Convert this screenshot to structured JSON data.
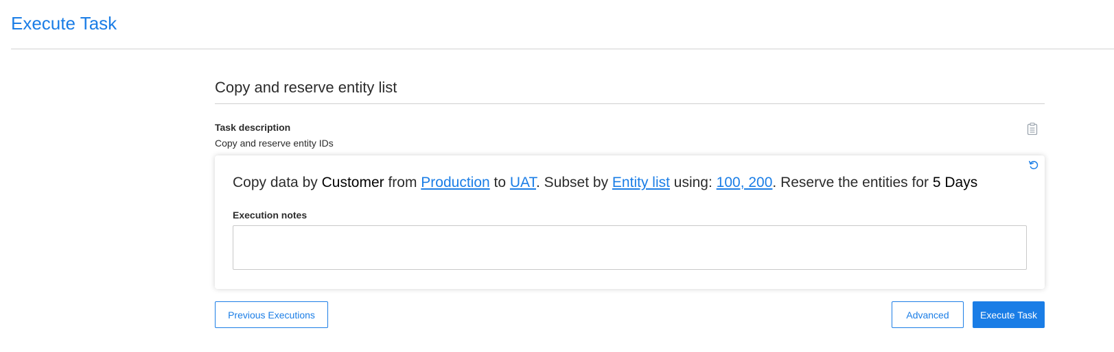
{
  "page": {
    "title": "Execute Task"
  },
  "task": {
    "name": "Copy and reserve entity list",
    "description_label": "Task description",
    "description": "Copy and reserve entity IDs"
  },
  "summary": {
    "t1": "Copy data by ",
    "entity": "Customer",
    "t2": " from ",
    "source": "Production",
    "t3": " to ",
    "target": "UAT",
    "t4": ". Subset by ",
    "subset": "Entity list",
    "t5": " using: ",
    "entities": "100, 200",
    "t6": ". Reserve the entities for ",
    "duration": "5 Days"
  },
  "notes": {
    "label": "Execution notes",
    "value": "",
    "placeholder": ""
  },
  "buttons": {
    "previous": "Previous Executions",
    "advanced": "Advanced",
    "execute": "Execute Task"
  },
  "icons": {
    "clipboard": "clipboard-icon",
    "refresh": "refresh-icon"
  },
  "colors": {
    "accent": "#1a7de6",
    "text": "#2b2b2b",
    "divider": "#d2d2d2"
  }
}
